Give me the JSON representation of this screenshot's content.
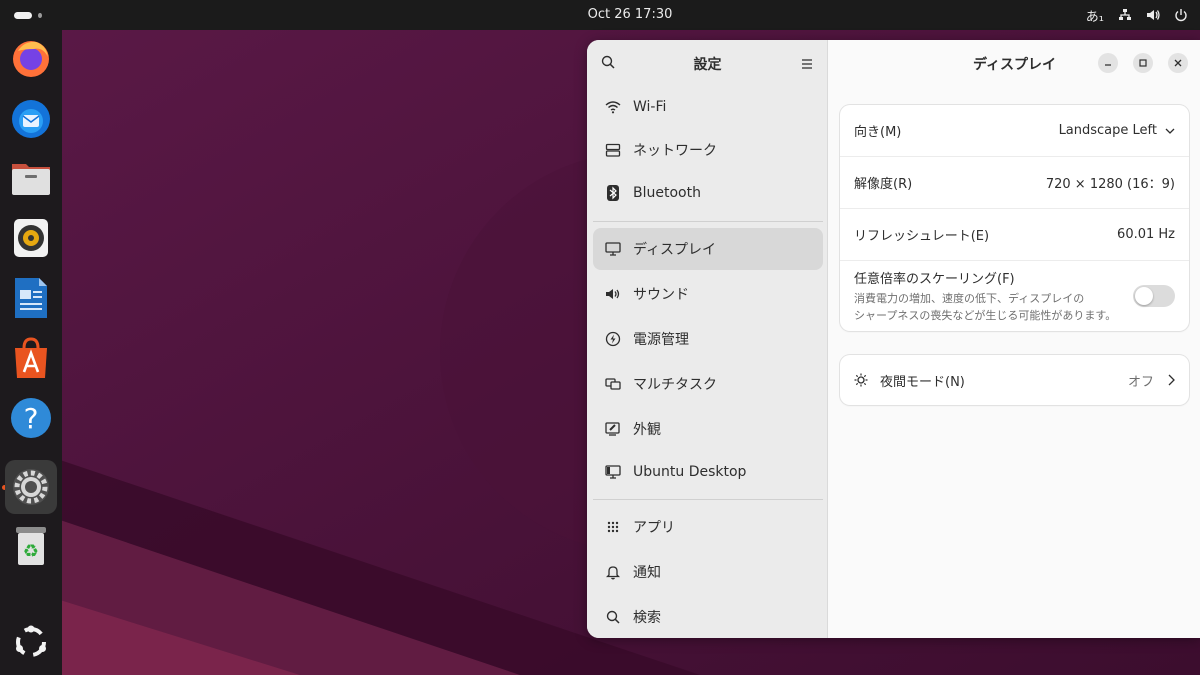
{
  "topbar": {
    "clock": "Oct 26  17:30",
    "input_method": "あ₁"
  },
  "dock": {
    "apps": [
      {
        "name": "firefox-icon"
      },
      {
        "name": "thunderbird-icon"
      },
      {
        "name": "files-icon"
      },
      {
        "name": "rhythmbox-icon"
      },
      {
        "name": "libreoffice-writer-icon"
      },
      {
        "name": "app-center-icon"
      },
      {
        "name": "help-icon"
      },
      {
        "name": "settings-icon"
      },
      {
        "name": "trash-icon"
      },
      {
        "name": "show-apps-icon"
      }
    ]
  },
  "sidebar": {
    "title": "設定",
    "items": [
      {
        "label": "Wi-Fi",
        "icon": "wifi-icon"
      },
      {
        "label": "ネットワーク",
        "icon": "network-icon"
      },
      {
        "label": "Bluetooth",
        "icon": "bluetooth-icon"
      },
      {
        "label": "ディスプレイ",
        "icon": "display-icon"
      },
      {
        "label": "サウンド",
        "icon": "sound-icon"
      },
      {
        "label": "電源管理",
        "icon": "power-icon"
      },
      {
        "label": "マルチタスク",
        "icon": "multitasking-icon"
      },
      {
        "label": "外観",
        "icon": "appearance-icon"
      },
      {
        "label": "Ubuntu Desktop",
        "icon": "ubuntu-desktop-icon"
      },
      {
        "label": "アプリ",
        "icon": "apps-icon"
      },
      {
        "label": "通知",
        "icon": "notifications-icon"
      },
      {
        "label": "検索",
        "icon": "search-icon"
      }
    ]
  },
  "content": {
    "title": "ディスプレイ",
    "orientation": {
      "label": "向き(M)",
      "value": "Landscape Left"
    },
    "resolution": {
      "label": "解像度(R)",
      "value": "720 × 1280 (16：9)"
    },
    "refresh_rate": {
      "label": "リフレッシュレート(E)",
      "value": "60.01 Hz"
    },
    "fractional_scaling": {
      "label": "任意倍率のスケーリング(F)",
      "description_line1": "消費電力の増加、速度の低下、ディスプレイの",
      "description_line2": "シャープネスの喪失などが生じる可能性があります。",
      "enabled": false
    },
    "night_light": {
      "label": "夜間モード(N)",
      "value": "オフ"
    }
  },
  "colors": {
    "accent": "#e95420",
    "sidebar_bg": "#ebebeb",
    "selected_bg": "#d8d8d8",
    "topbar_bg": "#1b1b1b"
  }
}
